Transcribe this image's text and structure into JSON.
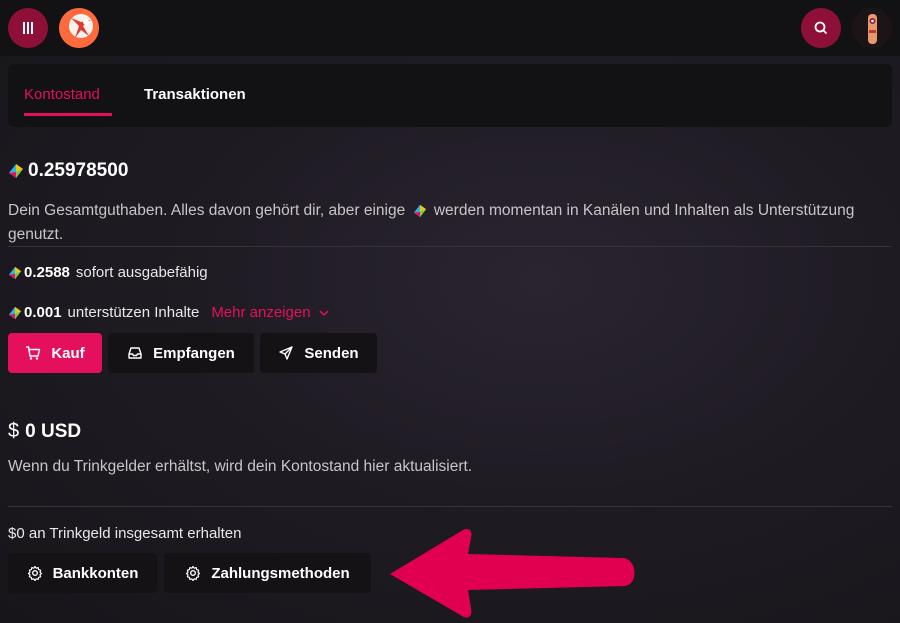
{
  "tabs": [
    {
      "label": "Kontostand",
      "active": true
    },
    {
      "label": "Transaktionen",
      "active": false
    }
  ],
  "balance": {
    "total": "0.25978500",
    "description_part1": "Dein Gesamtguthaben. Alles davon gehört dir, aber einige",
    "description_part2": "werden momentan in Kanälen und Inhalten als Unterstützung genutzt."
  },
  "spendable": {
    "amount": "0.2588",
    "label": "sofort ausgabefähig"
  },
  "supporting": {
    "amount": "0.001",
    "label": "unterstützen Inhalte",
    "more_label": "Mehr anzeigen"
  },
  "actions": {
    "buy": "Kauf",
    "receive": "Empfangen",
    "send": "Senden"
  },
  "usd": {
    "symbol": "$",
    "amount": "0 USD",
    "description": "Wenn du Trinkgelder erhältst, wird dein Kontostand hier aktualisiert."
  },
  "tips": {
    "total_label": "$0 an Trinkgeld insgesamt erhalten"
  },
  "payout_actions": {
    "bank_accounts": "Bankkonten",
    "payment_methods": "Zahlungsmethoden"
  },
  "colors": {
    "accent": "#e5105d",
    "header_button": "#8e1038",
    "panel": "#121113",
    "arrow": "#e0004f"
  },
  "icons": [
    "menu-icon",
    "lbry-logo",
    "search-icon",
    "user-avatar",
    "lbc-icon",
    "cart-icon",
    "inbox-icon",
    "send-icon",
    "dollar-icon",
    "gear-icon",
    "chevron-down-icon"
  ]
}
